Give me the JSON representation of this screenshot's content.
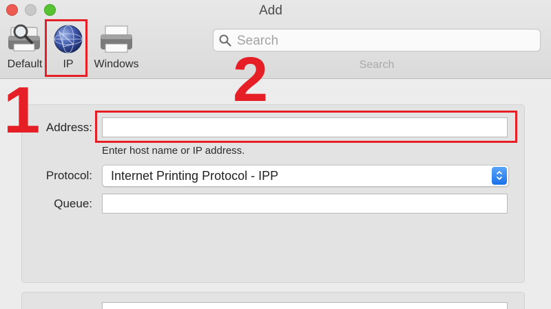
{
  "window": {
    "title": "Add"
  },
  "toolbar": {
    "items": [
      {
        "label": "Default",
        "icon": "printer-search-icon"
      },
      {
        "label": "IP",
        "icon": "globe-icon"
      },
      {
        "label": "Windows",
        "icon": "printer-icon"
      }
    ],
    "search": {
      "placeholder": "Search",
      "caption": "Search"
    }
  },
  "form": {
    "address": {
      "label": "Address:",
      "value": "",
      "hint": "Enter host name or IP address."
    },
    "protocol": {
      "label": "Protocol:",
      "value": "Internet Printing Protocol - IPP"
    },
    "queue": {
      "label": "Queue:",
      "value": ""
    }
  },
  "annotations": {
    "step_1": "1",
    "step_2": "2",
    "color": "#e51f25"
  },
  "colors": {
    "accent": "#1a72ea",
    "close": "#ee5b53",
    "zoom": "#58c332"
  }
}
